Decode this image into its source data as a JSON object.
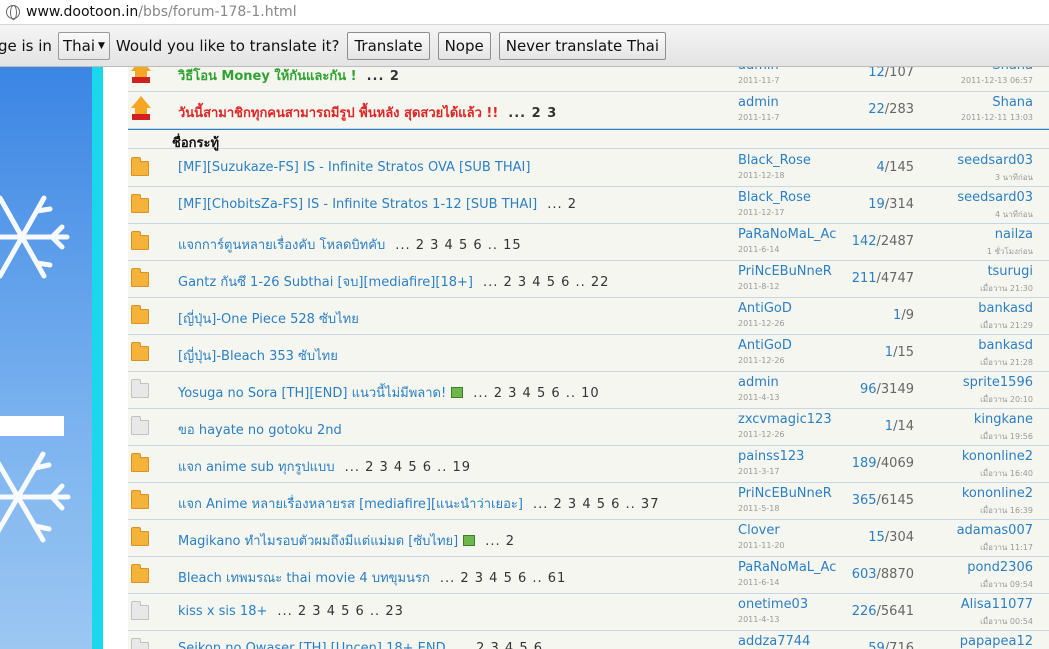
{
  "browser": {
    "url_domain": "www.dootoon.in",
    "url_path": "/bbs/forum-178-1.html"
  },
  "translate_bar": {
    "lead_text": "ge is in",
    "language": "Thai",
    "question": "Would you like to translate it?",
    "translate_label": "Translate",
    "nope_label": "Nope",
    "never_label": "Never translate Thai"
  },
  "section_header": "ชื่อกระทู้",
  "sticky_threads": [
    {
      "title": "วิธีโอน Money ให้กันและกัน !",
      "pages": "... 2",
      "author": "admin",
      "author_date": "2011-11-7",
      "replies": "12",
      "views": "107",
      "last_poster": "Shana",
      "last_time": "2011-12-13 06:57",
      "color": "#2fa32f"
    },
    {
      "title": "วันนี้สามาชิกทุกคนสามารถมีรูป พื้นหลัง สุดสวยได้แล้ว !!",
      "pages": "... 2  3",
      "author": "admin",
      "author_date": "2011-11-7",
      "replies": "22",
      "views": "283",
      "last_poster": "Shana",
      "last_time": "2011-12-11 13:03",
      "color": "#e02525"
    }
  ],
  "threads": [
    {
      "icon": "folder-new",
      "title": "[MF][Suzukaze-FS] IS - Infinite Stratos OVA [SUB THAI]",
      "pages": "",
      "attach": false,
      "author": "Black_Rose",
      "author_date": "2011-12-18",
      "replies": "4",
      "views": "145",
      "last_poster": "seedsard03",
      "last_time": "3 นาทีก่อน"
    },
    {
      "icon": "folder-new",
      "title": "[MF][ChobitsZa-FS] IS - Infinite Stratos 1-12 [SUB THAI]",
      "pages": "... 2",
      "attach": false,
      "author": "Black_Rose",
      "author_date": "2011-12-17",
      "replies": "19",
      "views": "314",
      "last_poster": "seedsard03",
      "last_time": "4 นาทีก่อน"
    },
    {
      "icon": "folder-new",
      "title": "แจกการ์ตูนหลายเรื่องคับ โหลดบิทคับ",
      "pages": "... 2 3 4 5 6 .. 15",
      "attach": false,
      "author": "PaRaNoMaL_Ac",
      "author_date": "2011-6-14",
      "replies": "142",
      "views": "2487",
      "last_poster": "nailza",
      "last_time": "1 ชั่วโมงก่อน"
    },
    {
      "icon": "folder-new",
      "title": "Gantz กันซึ 1-26 Subthai [จบ][mediafire][18+]",
      "pages": "... 2 3 4 5 6 .. 22",
      "attach": false,
      "author": "PriNcEBuNneR",
      "author_date": "2011-8-12",
      "replies": "211",
      "views": "4747",
      "last_poster": "tsurugi",
      "last_time": "เมื่อวาน 21:30"
    },
    {
      "icon": "folder-new",
      "title": "[ญี่ปุ่น]-One Piece 528 ซับไทย",
      "pages": "",
      "attach": false,
      "author": "AntiGoD",
      "author_date": "2011-12-26",
      "replies": "1",
      "views": "9",
      "last_poster": "bankasd",
      "last_time": "เมื่อวาน 21:29"
    },
    {
      "icon": "folder-new",
      "title": "[ญี่ปุ่น]-Bleach 353 ซับไทย",
      "pages": "",
      "attach": false,
      "author": "AntiGoD",
      "author_date": "2011-12-26",
      "replies": "1",
      "views": "15",
      "last_poster": "bankasd",
      "last_time": "เมื่อวาน 21:28"
    },
    {
      "icon": "folder-old",
      "title": "Yosuga no Sora [TH][END] แนวนี้ไม่มีพลาด!",
      "pages": "... 2 3 4 5 6 .. 10",
      "attach": true,
      "author": "admin",
      "author_date": "2011-4-13",
      "replies": "96",
      "views": "3149",
      "last_poster": "sprite1596",
      "last_time": "เมื่อวาน 20:10"
    },
    {
      "icon": "folder-old",
      "title": "ขอ hayate no gotoku 2nd",
      "pages": "",
      "attach": false,
      "author": "zxcvmagic123",
      "author_date": "2011-12-26",
      "replies": "1",
      "views": "14",
      "last_poster": "kingkane",
      "last_time": "เมื่อวาน 19:56"
    },
    {
      "icon": "folder-new",
      "title": "แจก anime sub ทุกรูปแบบ",
      "pages": "... 2 3 4 5 6 .. 19",
      "attach": false,
      "author": "painss123",
      "author_date": "2011-3-17",
      "replies": "189",
      "views": "4069",
      "last_poster": "kononline2",
      "last_time": "เมื่อวาน 16:40"
    },
    {
      "icon": "folder-new",
      "title": "แจก Anime หลายเรื่องหลายรส [mediafire][แนะนำว่าเยอะ]",
      "pages": "... 2 3 4 5 6 .. 37",
      "attach": false,
      "author": "PriNcEBuNneR",
      "author_date": "2011-5-18",
      "replies": "365",
      "views": "6145",
      "last_poster": "kononline2",
      "last_time": "เมื่อวาน 16:39"
    },
    {
      "icon": "folder-new",
      "title": "Magikano ทำไมรอบตัวผมถึงมีแต่แม่มด [ซับไทย]",
      "pages": "... 2",
      "attach": true,
      "author": "Clover",
      "author_date": "2011-11-20",
      "replies": "15",
      "views": "304",
      "last_poster": "adamas007",
      "last_time": "เมื่อวาน 11:17"
    },
    {
      "icon": "folder-new",
      "title": "Bleach เทพมรณะ thai movie 4 บทขุมนรก",
      "pages": "... 2 3 4 5 6 .. 61",
      "attach": false,
      "author": "PaRaNoMaL_Ac",
      "author_date": "2011-6-14",
      "replies": "603",
      "views": "8870",
      "last_poster": "pond2306",
      "last_time": "เมื่อวาน 09:54"
    },
    {
      "icon": "folder-old",
      "title": "kiss x sis 18+",
      "pages": "... 2 3 4 5 6 .. 23",
      "attach": false,
      "author": "onetime03",
      "author_date": "2011-4-13",
      "replies": "226",
      "views": "5641",
      "last_poster": "Alisa11077",
      "last_time": "เมื่อวาน 00:54"
    },
    {
      "icon": "folder-old",
      "title": "Seikon no Qwaser [TH] [Uncen] 18+ END",
      "pages": "... 2 3 4 5 6",
      "attach": false,
      "author": "addza7744",
      "author_date": "",
      "replies": "59",
      "views": "716",
      "last_poster": "papapea12",
      "last_time": ""
    }
  ]
}
